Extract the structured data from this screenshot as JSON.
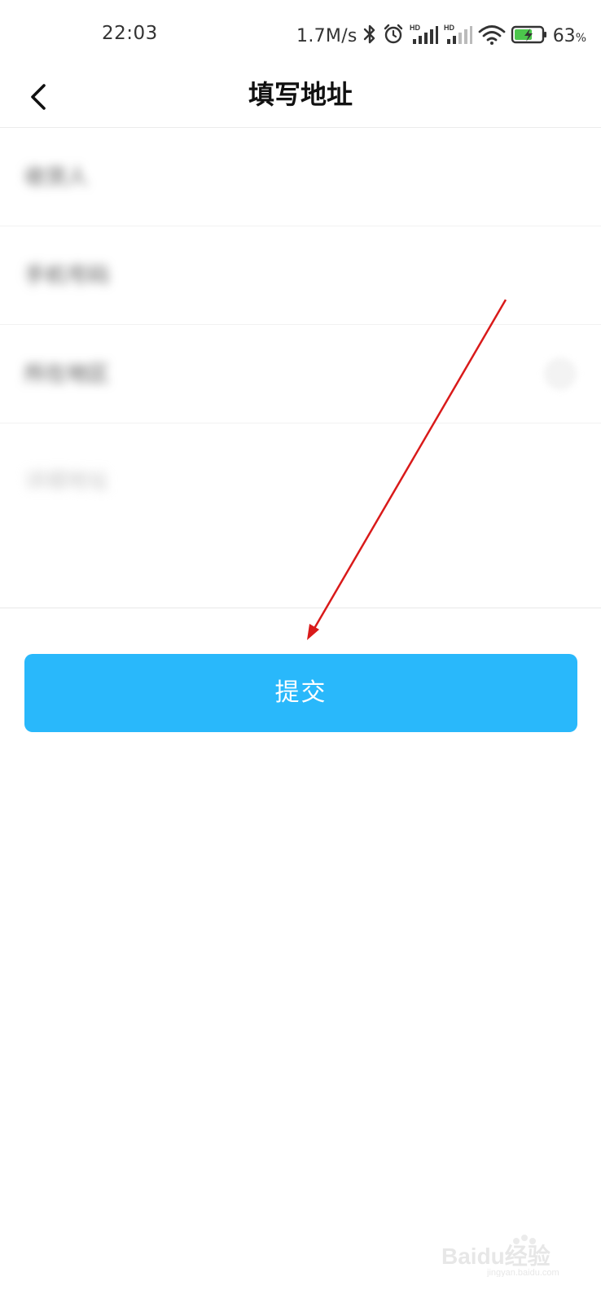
{
  "status_bar": {
    "time": "22:03",
    "net_speed": "1.7M/s",
    "battery_percent": "63",
    "battery_unit": "%",
    "icons": [
      "bluetooth-icon",
      "alarm-icon",
      "signal-hd-icon",
      "signal-hd-icon",
      "wifi-icon",
      "battery-charging-icon"
    ]
  },
  "nav": {
    "back_icon": "chevron-left-icon",
    "title": "填写地址"
  },
  "form": {
    "rows": [
      {
        "label": "收货人"
      },
      {
        "label": "手机号码"
      },
      {
        "label": "所在地区"
      },
      {
        "label": "详细地址"
      }
    ]
  },
  "submit_label": "提交",
  "annotation": {
    "color": "#d91a1a"
  },
  "watermark": {
    "text": "Baidu经验",
    "subtext": "jingyan.baidu.com"
  },
  "colors": {
    "primary": "#29b8fb",
    "text": "#111111"
  }
}
